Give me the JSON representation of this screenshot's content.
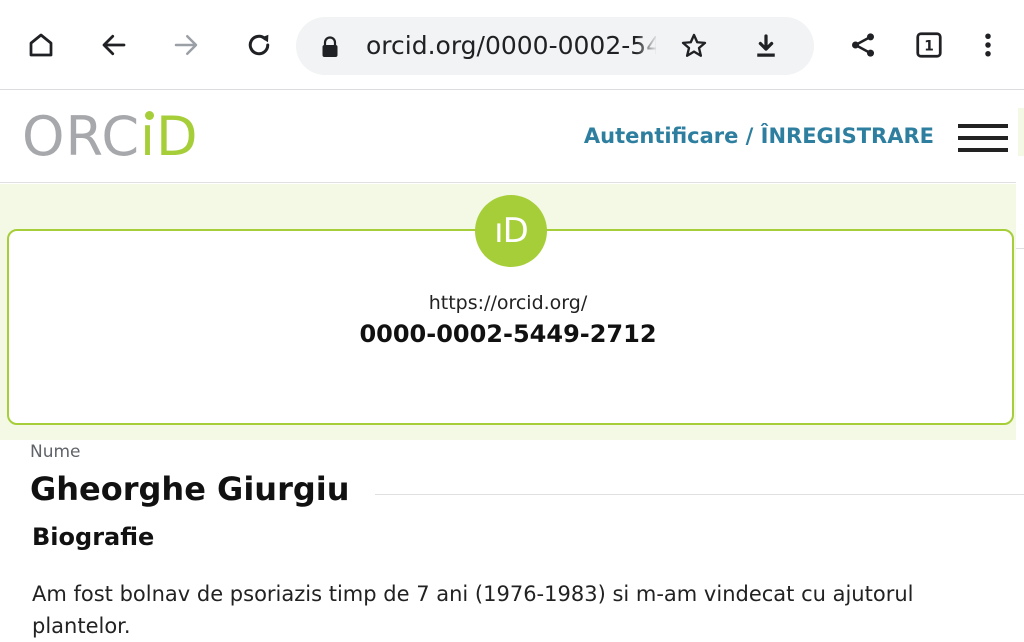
{
  "browser": {
    "url": "orcid.org/0000-0002-5449-2712",
    "tab_count": "1",
    "icons": [
      "home-icon",
      "back-icon",
      "forward-icon",
      "reload-icon",
      "lock-icon",
      "star-icon",
      "download-icon",
      "share-icon",
      "tab-switcher-icon",
      "more-vert-icon"
    ]
  },
  "header": {
    "logo": {
      "gray": "ORC",
      "green": "ıD"
    },
    "auth_link": "Autentificare / ÎNREGISTRARE",
    "menu_icon": "hamburger-menu-icon"
  },
  "id_card": {
    "badge": "ıD",
    "base_url": "https://orcid.org/",
    "orcid_id": "0000-0002-5449-2712"
  },
  "profile": {
    "name_label": "Nume",
    "name": "Gheorghe Giurgiu",
    "bio_heading": "Biografie",
    "bio_text": "Am fost bolnav de psoriazis timp de 7 ani (1976-1983) si m-am vindecat cu ajutorul plantelor."
  },
  "colors": {
    "orcid_green": "#a6ce39",
    "logo_gray": "#a6a8ab",
    "link_teal": "#2e7f9f",
    "banner_bg": "#f3f9e5",
    "omnibox_bg": "#f1f3f4"
  }
}
